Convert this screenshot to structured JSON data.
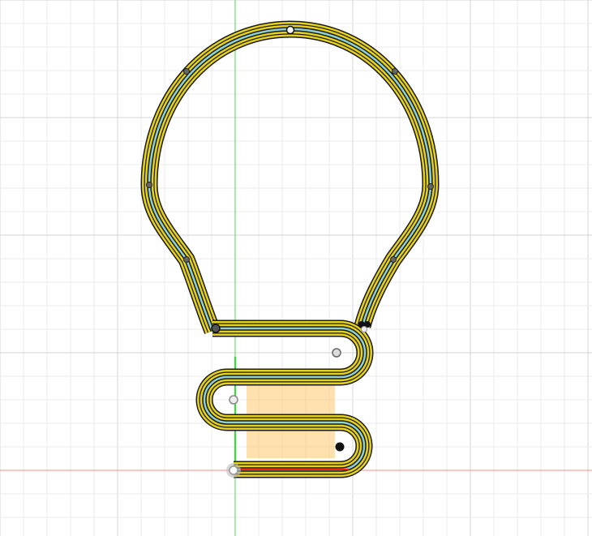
{
  "canvas": {
    "name": "sketch-canvas",
    "colors": {
      "background": "#ffffff",
      "grid_minor": "#ebebeb",
      "grid_major": "#d4d4d4",
      "axis_x": "#ff8080",
      "axis_y": "#33dd33",
      "profile_fill": "#e6d21a",
      "profile_outline": "#1a1a1a",
      "centerline": "#8fd0d0",
      "selection_fill": "#ffc870",
      "constraint_red": "#ff2200"
    }
  }
}
